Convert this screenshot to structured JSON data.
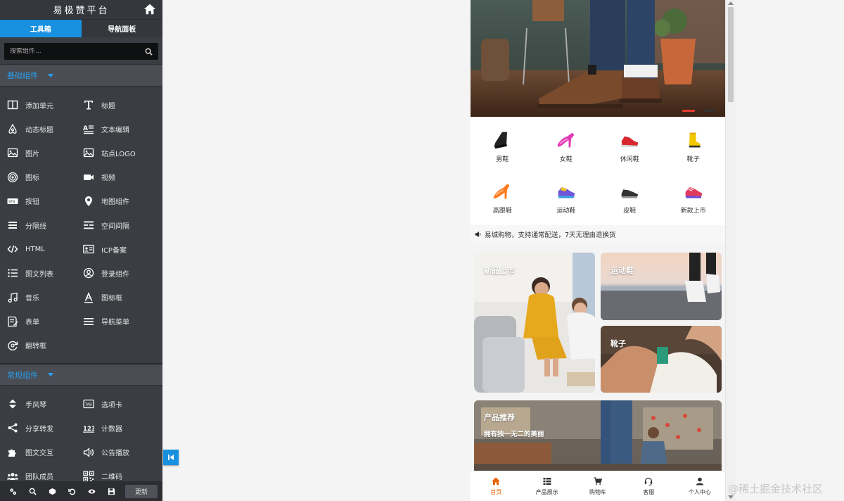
{
  "sidebar": {
    "title": "易极赞平台",
    "tabs": [
      "工具箱",
      "导航面板"
    ],
    "search_placeholder": "搜索组件...",
    "sections": [
      {
        "title": "基础组件",
        "items": [
          {
            "label": "添加单元",
            "icon": "layout-columns-icon"
          },
          {
            "label": "标题",
            "icon": "title-t-icon"
          },
          {
            "label": "动态标题",
            "icon": "airbnb-icon"
          },
          {
            "label": "文本编辑",
            "icon": "text-edit-icon"
          },
          {
            "label": "图片",
            "icon": "image-icon"
          },
          {
            "label": "站点LOGO",
            "icon": "logo-image-icon"
          },
          {
            "label": "图标",
            "icon": "target-icon"
          },
          {
            "label": "视频",
            "icon": "video-camera-icon"
          },
          {
            "label": "按钮",
            "icon": "btn-icon"
          },
          {
            "label": "地图组件",
            "icon": "map-pin-icon"
          },
          {
            "label": "分隔线",
            "icon": "divider-icon"
          },
          {
            "label": "空间间隔",
            "icon": "spacing-icon"
          },
          {
            "label": "HTML",
            "icon": "code-icon"
          },
          {
            "label": "ICP备案",
            "icon": "id-card-icon"
          },
          {
            "label": "图文列表",
            "icon": "list-icon"
          },
          {
            "label": "登录组件",
            "icon": "user-circle-icon"
          },
          {
            "label": "音乐",
            "icon": "music-icon"
          },
          {
            "label": "图标框",
            "icon": "font-a-icon"
          },
          {
            "label": "表单",
            "icon": "form-icon"
          },
          {
            "label": "导航菜单",
            "icon": "menu-icon"
          },
          {
            "label": "翻转框",
            "icon": "flip-icon"
          }
        ]
      },
      {
        "title": "常规组件",
        "items": [
          {
            "label": "手风琴",
            "icon": "accordion-icon"
          },
          {
            "label": "选项卡",
            "icon": "tab-icon"
          },
          {
            "label": "分享转发",
            "icon": "share-icon"
          },
          {
            "label": "计数器",
            "icon": "counter-123-icon"
          },
          {
            "label": "图文交互",
            "icon": "puzzle-icon"
          },
          {
            "label": "公告播放",
            "icon": "speaker-icon"
          },
          {
            "label": "团队成员",
            "icon": "team-icon"
          },
          {
            "label": "二维码",
            "icon": "qrcode-icon"
          }
        ]
      }
    ],
    "footer": {
      "icons": [
        "settings-icon",
        "search-icon",
        "cube-icon",
        "undo-icon",
        "eye-icon",
        "save-icon"
      ],
      "update_label": "更新"
    }
  },
  "preview": {
    "categories": [
      {
        "label": "男鞋",
        "icon": "mens-shoe-icon"
      },
      {
        "label": "女鞋",
        "icon": "womens-heel-icon"
      },
      {
        "label": "休闲鞋",
        "icon": "casual-shoe-icon"
      },
      {
        "label": "靴子",
        "icon": "boot-icon"
      },
      {
        "label": "高跟鞋",
        "icon": "high-heel-icon"
      },
      {
        "label": "运动鞋",
        "icon": "sneaker-icon"
      },
      {
        "label": "皮鞋",
        "icon": "leather-shoe-icon"
      },
      {
        "label": "新款上市",
        "icon": "new-sneaker-icon"
      }
    ],
    "notice": "易城购物，支持通常配送，7天无理由退换货",
    "promos": {
      "new": "新品上市",
      "sport": "运动鞋",
      "boots": "靴子",
      "recommend_title": "产品推荐",
      "recommend_subtitle": "拥有独一无二的美丽"
    },
    "tabbar": [
      {
        "label": "首页",
        "icon": "home-icon"
      },
      {
        "label": "产品展示",
        "icon": "grid-list-icon"
      },
      {
        "label": "购物车",
        "icon": "cart-icon"
      },
      {
        "label": "客服",
        "icon": "headset-icon"
      },
      {
        "label": "个人中心",
        "icon": "person-icon"
      }
    ],
    "active_tab": 0,
    "accent_color": "#e8630a"
  },
  "watermark": "@稀土掘金技术社区",
  "colors": {
    "primary": "#1890e0",
    "sidebar_bg": "#3a3d42"
  }
}
